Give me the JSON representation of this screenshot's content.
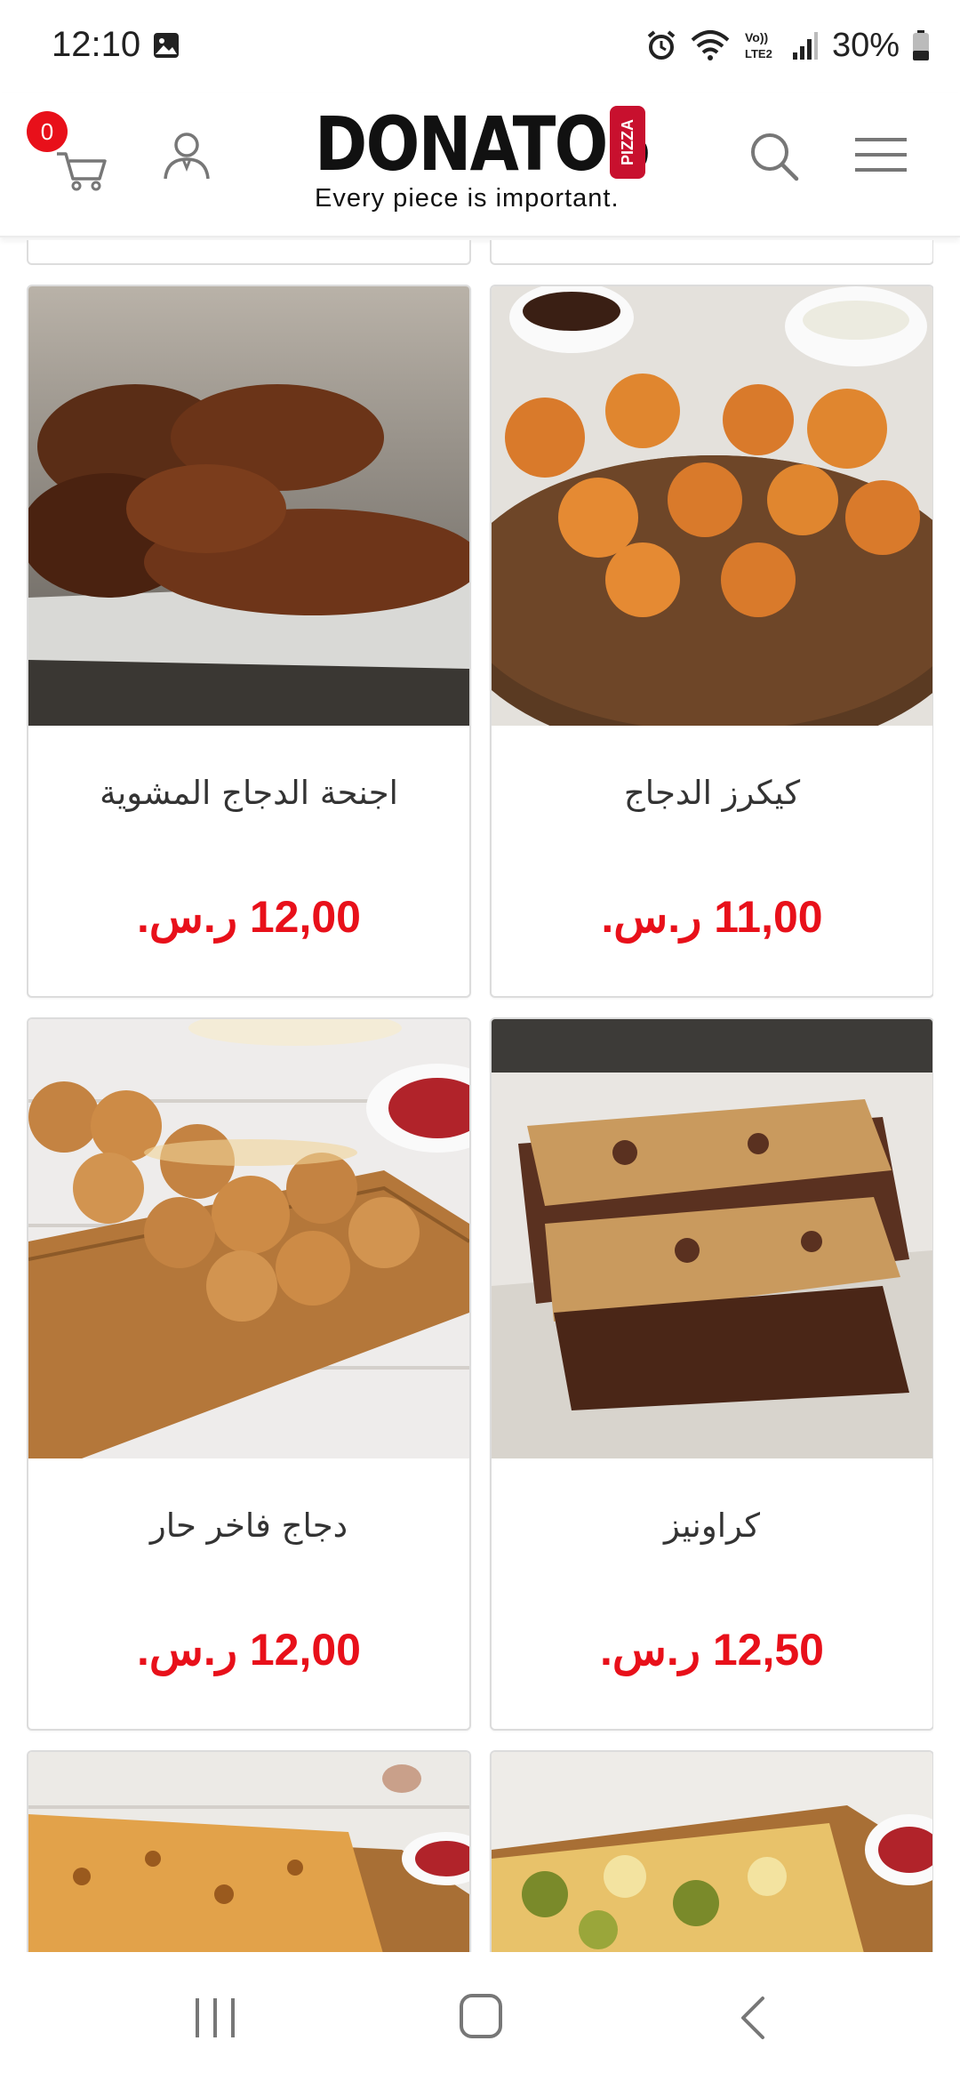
{
  "status_bar": {
    "time": "12:10",
    "battery": "30%",
    "icons": [
      "image-icon",
      "alarm-icon",
      "wifi-icon",
      "volte-icon",
      "signal-icon",
      "battery-icon"
    ]
  },
  "header": {
    "cart_count": "0",
    "logo_text": "DONATOS",
    "logo_badge": "PIZZA",
    "tagline": "Every piece is important.",
    "icons": [
      "cart-icon",
      "user-icon",
      "search-icon",
      "hamburger-menu-icon"
    ]
  },
  "products": [
    {
      "name": "اجنحة الدجاج المشوية",
      "price": "12,00 ر.س."
    },
    {
      "name": "كيكرز الدجاج",
      "price": "11,00 ر.س."
    },
    {
      "name": "دجاج فاخر حار",
      "price": "12,00 ر.س."
    },
    {
      "name": "كراونيز",
      "price": "12,50 ر.س."
    }
  ],
  "colors": {
    "accent": "#e8101a",
    "logo_red": "#c8102e",
    "card_border": "#dcdcdc"
  },
  "nav_bar": {
    "icons": [
      "recent-apps-icon",
      "home-icon",
      "back-icon"
    ]
  }
}
